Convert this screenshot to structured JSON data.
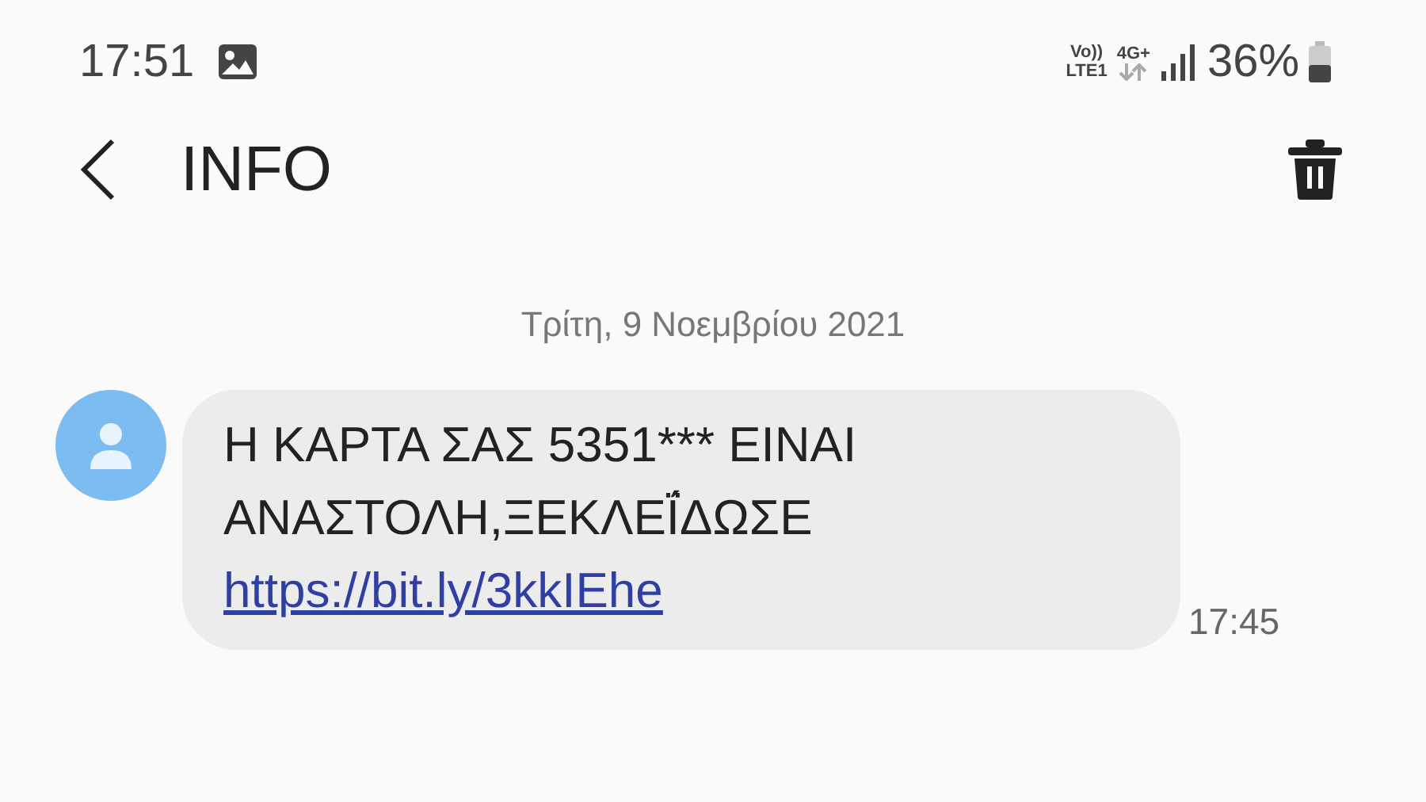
{
  "status_bar": {
    "time": "17:51",
    "volte": "Vo))",
    "lte": "LTE1",
    "network": "4G+",
    "battery": "36%"
  },
  "header": {
    "title": "INFO"
  },
  "date": "Τρίτη, 9 Νοεμβρίου 2021",
  "messages": [
    {
      "text": "Η ΚΑΡΤΑ ΣΑΣ 5351*** ΕΙΝΑΙ ΑΝΑΣΤΟΛΗ,ΞΕΚΛΕΪ́ΔΩΣΕ",
      "link": "https://bit.ly/3kkIEhe",
      "time": "17:45"
    }
  ]
}
